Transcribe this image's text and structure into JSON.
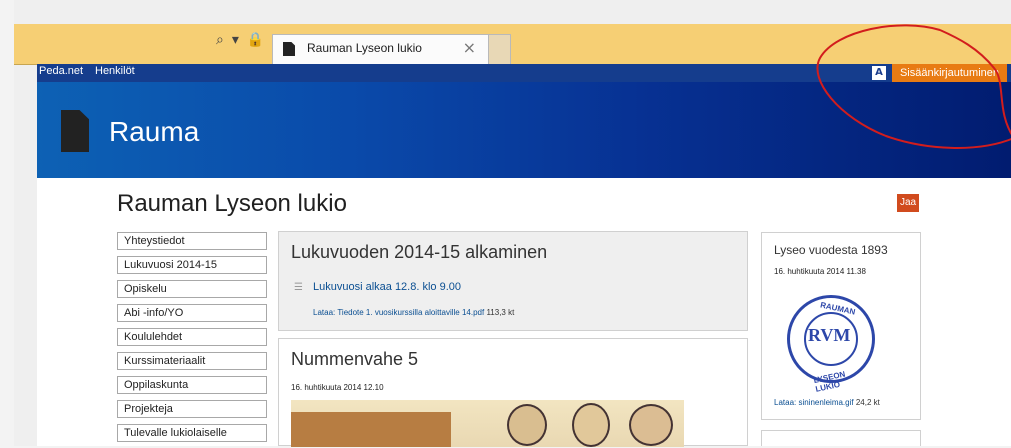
{
  "browser": {
    "tab_title": "Rauman Lyseon lukio",
    "tab_close": "×",
    "search_glyph": "⌕",
    "dropdown_glyph": "▾",
    "lock_glyph": "🔒",
    "refresh_glyph": "↻"
  },
  "top_nav": {
    "items": [
      {
        "label": "Peda.net"
      },
      {
        "label": "Henkilöt"
      }
    ],
    "login_label": "Sisäänkirjautuminen",
    "accessibility_label": "A"
  },
  "header": {
    "site_name": "Rauma"
  },
  "page": {
    "title": "Rauman Lyseon lukio",
    "share_label": "Jaa"
  },
  "sidebar": {
    "items": [
      {
        "label": "Yhteystiedot"
      },
      {
        "label": "Lukuvuosi 2014-15"
      },
      {
        "label": "Opiskelu"
      },
      {
        "label": "Abi -info/YO"
      },
      {
        "label": "Koululehdet"
      },
      {
        "label": "Kurssimateriaalit"
      },
      {
        "label": "Oppilaskunta"
      },
      {
        "label": "Projekteja"
      },
      {
        "label": "Tulevalle lukiolaiselle"
      }
    ]
  },
  "news_card": {
    "title": "Lukuvuoden 2014-15 alkaminen",
    "item_link": "Lukuvuosi alkaa 12.8. klo 9.00",
    "attachment_link": "Lataa: Tiedote 1. vuosikurssilla aloittaville 14.pdf",
    "attachment_size": "113,3 kt"
  },
  "feature_card": {
    "title": "Nummenvahe 5",
    "date": "16. huhtikuuta 2014 12.10"
  },
  "side_card": {
    "title": "Lyseo vuodesta 1893",
    "date": "16. huhtikuuta 2014 11.38",
    "seal_top": "RAUMAN",
    "seal_bottom": "LYSEON LUKIO",
    "seal_center": "RVM",
    "download_link": "Lataa: sininenleima.gif",
    "download_size": "24,2 kt"
  },
  "colors": {
    "browser_bar": "#f6cf74",
    "nav_blue": "#153d8d",
    "login_orange": "#e87b13",
    "share_red": "#d14b1e",
    "link_blue": "#0b4f92",
    "seal_blue": "#2d47a9"
  }
}
